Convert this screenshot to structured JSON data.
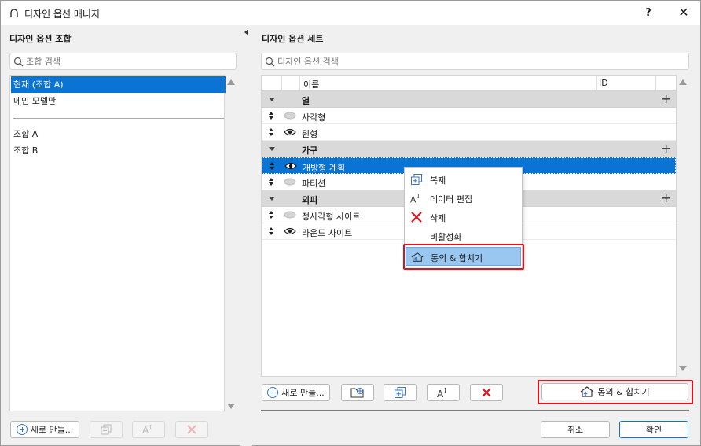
{
  "window": {
    "title": "디자인 옵션 매니저",
    "help_label": "?",
    "close_label": "✕"
  },
  "left_panel": {
    "heading": "디자인 옵션 조합",
    "search_placeholder": "조합 검색",
    "items": [
      {
        "label": "현재 (조합 A)",
        "selected": true
      },
      {
        "label": "메인 모델만",
        "selected": false
      }
    ],
    "items_after_separator": [
      {
        "label": "조합 A"
      },
      {
        "label": "조합 B"
      }
    ],
    "new_button_label": "새로 만들..."
  },
  "right_panel": {
    "heading": "디자인 옵션 세트",
    "search_placeholder": "디자인 옵션 검색",
    "columns": {
      "name": "이름",
      "id": "ID"
    },
    "groups": [
      {
        "label": "열",
        "options": [
          {
            "label": "사각형",
            "visible": false
          },
          {
            "label": "원형",
            "visible": true
          }
        ]
      },
      {
        "label": "가구",
        "options": [
          {
            "label": "개방형 계획",
            "visible": true,
            "selected": true
          },
          {
            "label": "파티션",
            "visible": false
          }
        ]
      },
      {
        "label": "외피",
        "options": [
          {
            "label": "정사각형 사이트",
            "visible": false
          },
          {
            "label": "라운드 사이트",
            "visible": true
          }
        ]
      }
    ],
    "new_button_label": "새로 만들...",
    "accept_merge_label": "동의 & 합치기"
  },
  "context_menu": {
    "items": [
      {
        "label": "복제",
        "icon": "duplicate-icon"
      },
      {
        "label": "데이터 편집",
        "icon": "edit-data-icon"
      },
      {
        "label": "삭제",
        "icon": "delete-icon"
      },
      {
        "label": "비활성화",
        "icon": ""
      },
      {
        "label": "동의 & 합치기",
        "icon": "accept-merge-icon",
        "highlighted": true
      }
    ]
  },
  "dialog_buttons": {
    "cancel": "취소",
    "ok": "확인"
  },
  "colors": {
    "selection": "#0a74d4",
    "highlight": "#99c7f0",
    "annotation_red": "#e0101c",
    "delete_red": "#e0101c",
    "icon_blue": "#3a75c4"
  }
}
